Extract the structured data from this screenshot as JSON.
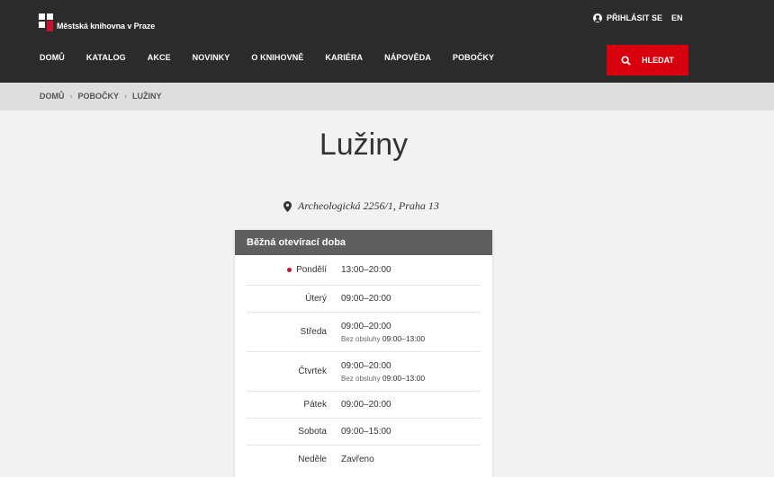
{
  "header": {
    "logo_text": "Městská knihovna v Praze",
    "login_label": "PŘIHLÁSIT SE",
    "lang_label": "EN",
    "nav": [
      "DOMŮ",
      "KATALOG",
      "AKCE",
      "NOVINKY",
      "O KNIHOVNĚ",
      "KARIÉRA",
      "NÁPOVĚDA",
      "POBOČKY"
    ],
    "search_label": "HLEDAT"
  },
  "breadcrumb": [
    "DOMŮ",
    "POBOČKY",
    "LUŽINY"
  ],
  "page": {
    "title": "Lužiny",
    "address": "Archeologická 2256/1, Praha 13"
  },
  "hours": {
    "header": "Běžná otevírací doba",
    "rows": [
      {
        "day": "Pondělí",
        "time": "13:00–20:00",
        "today": true
      },
      {
        "day": "Úterý",
        "time": "09:00–20:00"
      },
      {
        "day": "Středa",
        "time": "09:00–20:00",
        "note_label": "Bez obsluhy",
        "note_time": "09:00–13:00"
      },
      {
        "day": "Čtvrtek",
        "time": "09:00–20:00",
        "note_label": "Bez obsluhy",
        "note_time": "09:00–13:00"
      },
      {
        "day": "Pátek",
        "time": "09:00–20:00"
      },
      {
        "day": "Sobota",
        "time": "09:00–15:00"
      },
      {
        "day": "Neděle",
        "time": "Zavřeno"
      }
    ]
  },
  "colors": {
    "header_bg": "#2b2b2b",
    "accent_red": "#d8000c",
    "card_header_bg": "#5f5f5f"
  }
}
